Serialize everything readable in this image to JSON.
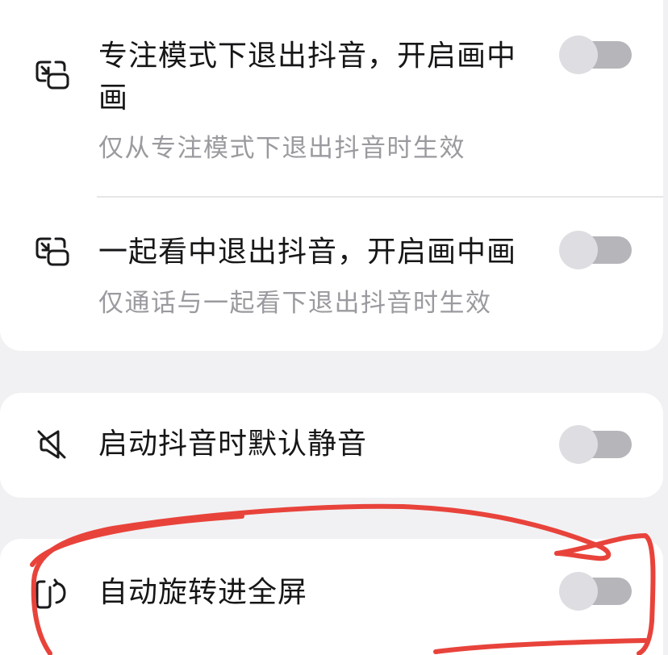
{
  "sections": [
    {
      "items": [
        {
          "icon": "picture-in-picture-exit-icon",
          "title": "专注模式下退出抖音，开启画中画",
          "subtitle": "仅从专注模式下退出抖音时生效",
          "enabled": false
        },
        {
          "icon": "picture-in-picture-exit-icon",
          "title": "一起看中退出抖音，开启画中画",
          "subtitle": "仅通话与一起看下退出抖音时生效",
          "enabled": false
        }
      ]
    },
    {
      "items": [
        {
          "icon": "mute-icon",
          "title": "启动抖音时默认静音",
          "enabled": false
        }
      ]
    },
    {
      "items": [
        {
          "icon": "rotate-screen-icon",
          "title": "自动旋转进全屏",
          "enabled": false
        }
      ]
    }
  ],
  "colors": {
    "bg": "#f1f1f3",
    "card": "#ffffff",
    "icon": "#1a1a1c",
    "title": "#161618",
    "subtitle": "#9a9a9f",
    "track": "#b5b5ba",
    "knob": "#dedee2",
    "divider": "#e6e6e8",
    "annotation": "#e8433b"
  }
}
